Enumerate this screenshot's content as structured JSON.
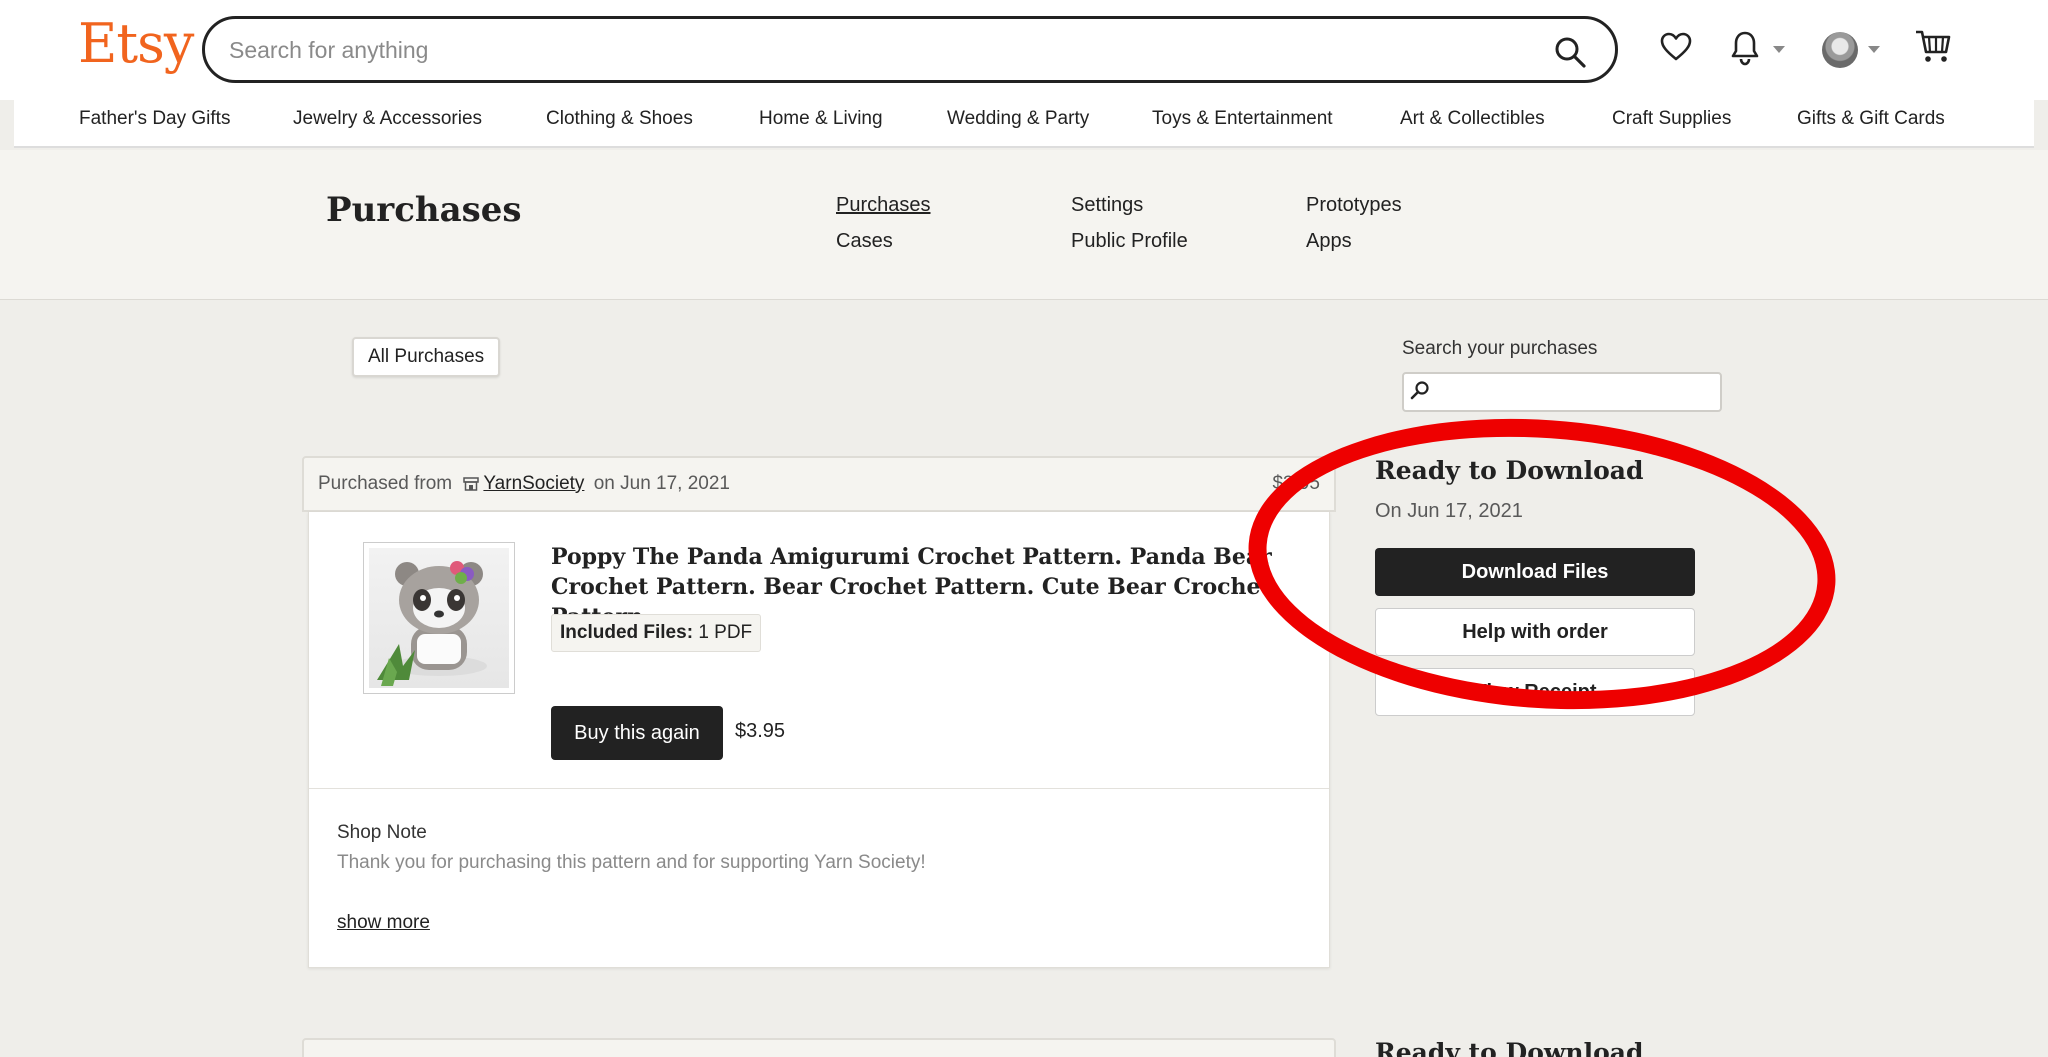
{
  "header": {
    "logo": "Etsy",
    "search_placeholder": "Search for anything",
    "icons": [
      "search-icon",
      "heart-icon",
      "bell-icon",
      "avatar",
      "cart-icon"
    ]
  },
  "categories": [
    "Father's Day Gifts",
    "Jewelry & Accessories",
    "Clothing & Shoes",
    "Home & Living",
    "Wedding & Party",
    "Toys & Entertainment",
    "Art & Collectibles",
    "Craft Supplies",
    "Gifts & Gift Cards"
  ],
  "account": {
    "title": "Purchases",
    "links": [
      "Purchases",
      "Cases",
      "Settings",
      "Public Profile",
      "Prototypes",
      "Apps"
    ],
    "active": "Purchases"
  },
  "filters": {
    "all_purchases": "All Purchases",
    "search_label": "Search your purchases"
  },
  "order": {
    "purchased_from": "Purchased from",
    "shop": "YarnSociety",
    "date_text": "on Jun 17, 2021",
    "price_header": "$3.95",
    "title": "Poppy The Panda Amigurumi Crochet Pattern. Panda Bear Crochet Pattern. Bear Crochet Pattern. Cute Bear Crochet Pattern.",
    "included_label": "Included Files:",
    "included_value": "1 PDF",
    "buy_again": "Buy this again",
    "price": "$3.95",
    "note_title": "Shop Note",
    "note_text": "Thank you for purchasing this pattern and for supporting Yarn Society!",
    "show_more": "show more"
  },
  "status": {
    "title": "Ready to Download",
    "date": "On Jun 17, 2021",
    "download": "Download Files",
    "help": "Help with order",
    "receipt": "View Receipt"
  },
  "next_status": {
    "title": "Ready to Download"
  },
  "colors": {
    "brand": "#f1641e",
    "annotation": "#e00000",
    "button_dark": "#222222"
  }
}
